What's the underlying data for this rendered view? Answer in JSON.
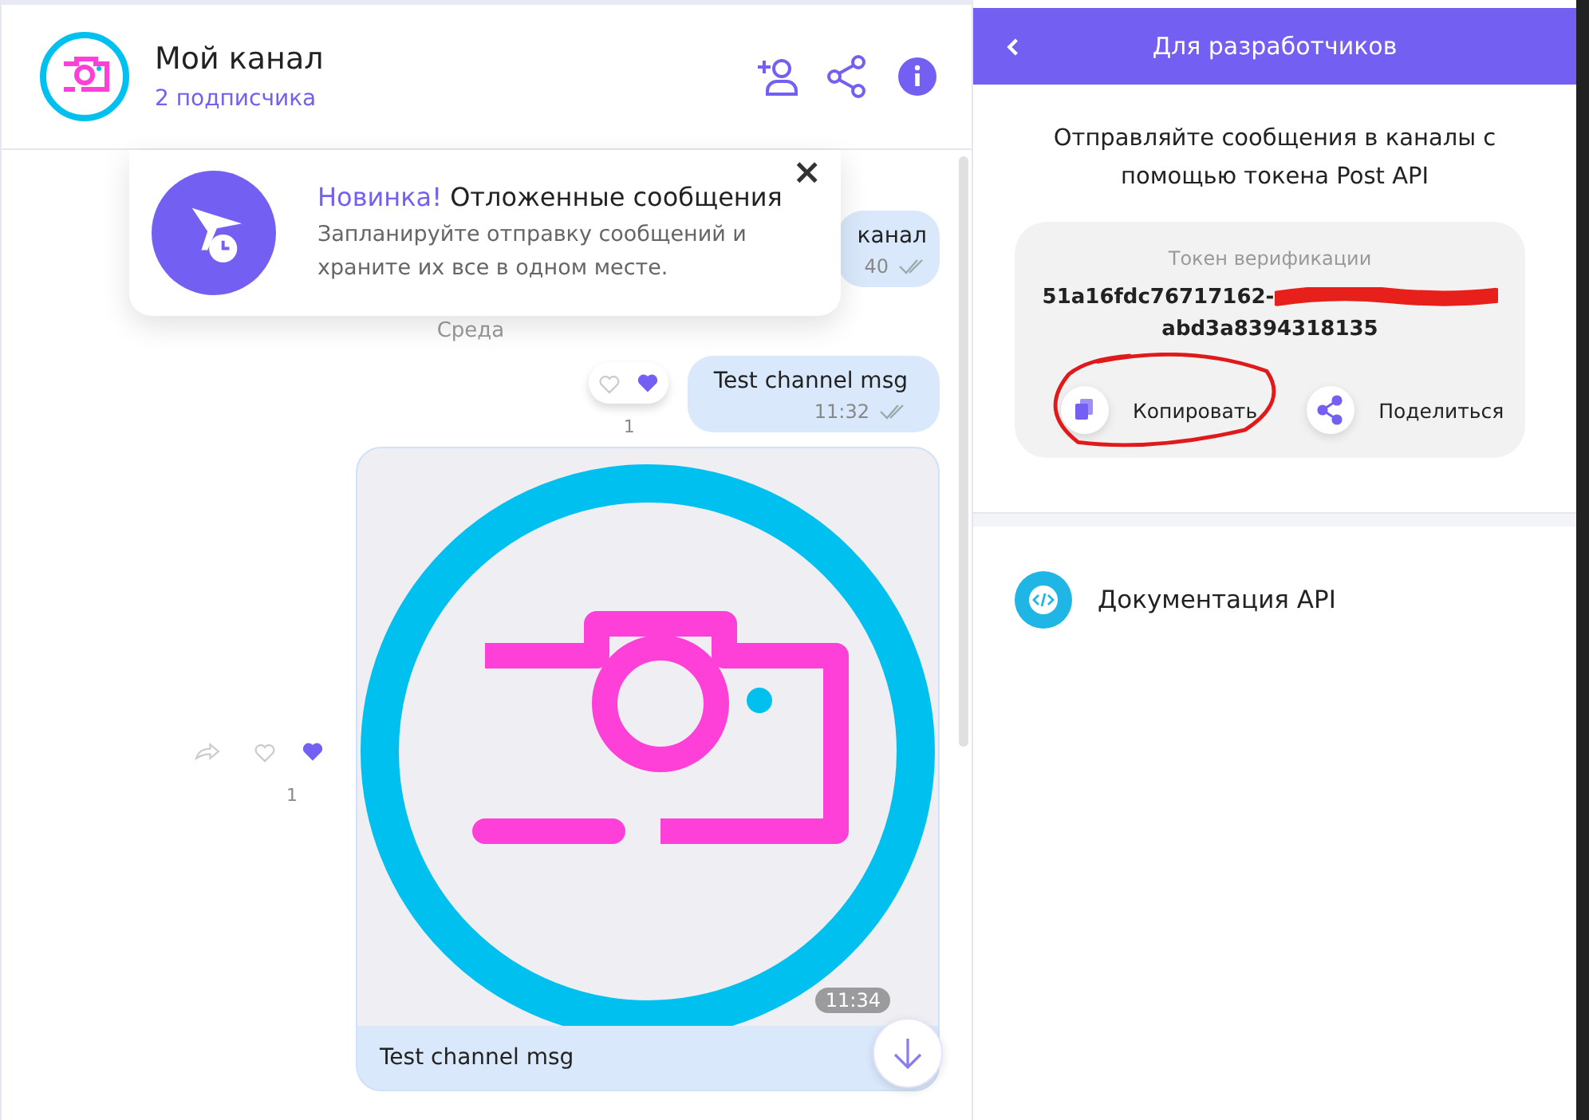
{
  "channel": {
    "name": "Мой канал",
    "subscribers": "2 подписчика"
  },
  "popup": {
    "highlight": "Новинка!",
    "title": "Отложенные сообщения",
    "text": "Запланируйте отправку сообщений и храните их все в одном месте.",
    "close": "×"
  },
  "messages": [
    {
      "kind": "text",
      "text": "канал",
      "time": "40"
    },
    {
      "kind": "date",
      "text": "Среда"
    },
    {
      "kind": "text",
      "text": "Test channel msg",
      "time": "11:32",
      "reactions": {
        "count": "1",
        "liked": true
      }
    },
    {
      "text": "Test channel msg",
      "time": "11:34",
      "reactions": {
        "count": "1",
        "liked": true
      }
    }
  ],
  "developer_panel": {
    "title": "Для разработчиков",
    "description": "Отправляйте сообщения в каналы с помощью токена Post API",
    "token_label": "Токен верификации",
    "token_line_1": "51a16fdc76717162-",
    "token_line_2": "abd3a8394318135",
    "actions": [
      "Копировать",
      "Поделиться"
    ],
    "docs_link": "Документация API"
  }
}
